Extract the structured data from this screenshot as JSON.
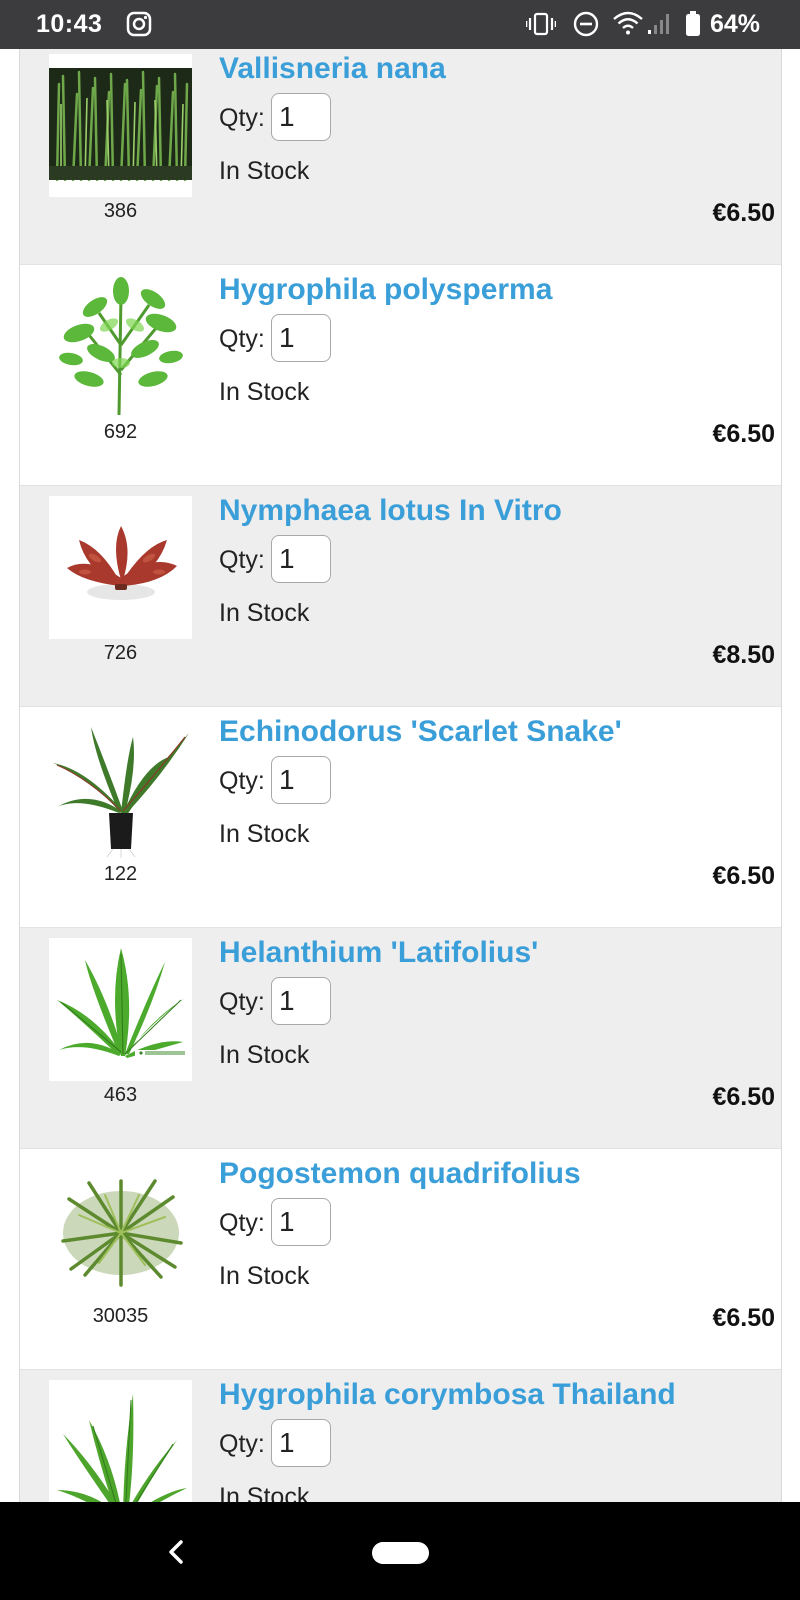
{
  "status_bar": {
    "time": "10:43",
    "battery_pct": "64%",
    "icons": [
      "instagram-icon",
      "vibrate-icon",
      "do-not-disturb-icon",
      "wifi-icon",
      "signal-icon",
      "battery-icon"
    ]
  },
  "products": [
    {
      "name": "Vallisneria nana",
      "qty_label": "Qty:",
      "qty": "1",
      "stock": "In Stock",
      "code": "386",
      "price": "€6.50"
    },
    {
      "name": "Hygrophila polysperma",
      "qty_label": "Qty:",
      "qty": "1",
      "stock": "In Stock",
      "code": "692",
      "price": "€6.50"
    },
    {
      "name": "Nymphaea lotus In Vitro",
      "qty_label": "Qty:",
      "qty": "1",
      "stock": "In Stock",
      "code": "726",
      "price": "€8.50"
    },
    {
      "name": "Echinodorus 'Scarlet Snake'",
      "qty_label": "Qty:",
      "qty": "1",
      "stock": "In Stock",
      "code": "122",
      "price": "€6.50"
    },
    {
      "name": "Helanthium 'Latifolius'",
      "qty_label": "Qty:",
      "qty": "1",
      "stock": "In Stock",
      "code": "463",
      "price": "€6.50"
    },
    {
      "name": "Pogostemon quadrifolius",
      "qty_label": "Qty:",
      "qty": "1",
      "stock": "In Stock",
      "code": "30035",
      "price": "€6.50"
    },
    {
      "name": "Hygrophila corymbosa Thailand",
      "qty_label": "Qty:",
      "qty": "1",
      "stock": "In Stock"
    }
  ],
  "colors": {
    "link_blue": "#3a9ed8",
    "row_shade": "#eeeeef",
    "status_bar": "#3c3c3f",
    "nav_bar": "#000000"
  },
  "nav_bar": {
    "icons": [
      "back-icon",
      "home-pill"
    ]
  }
}
